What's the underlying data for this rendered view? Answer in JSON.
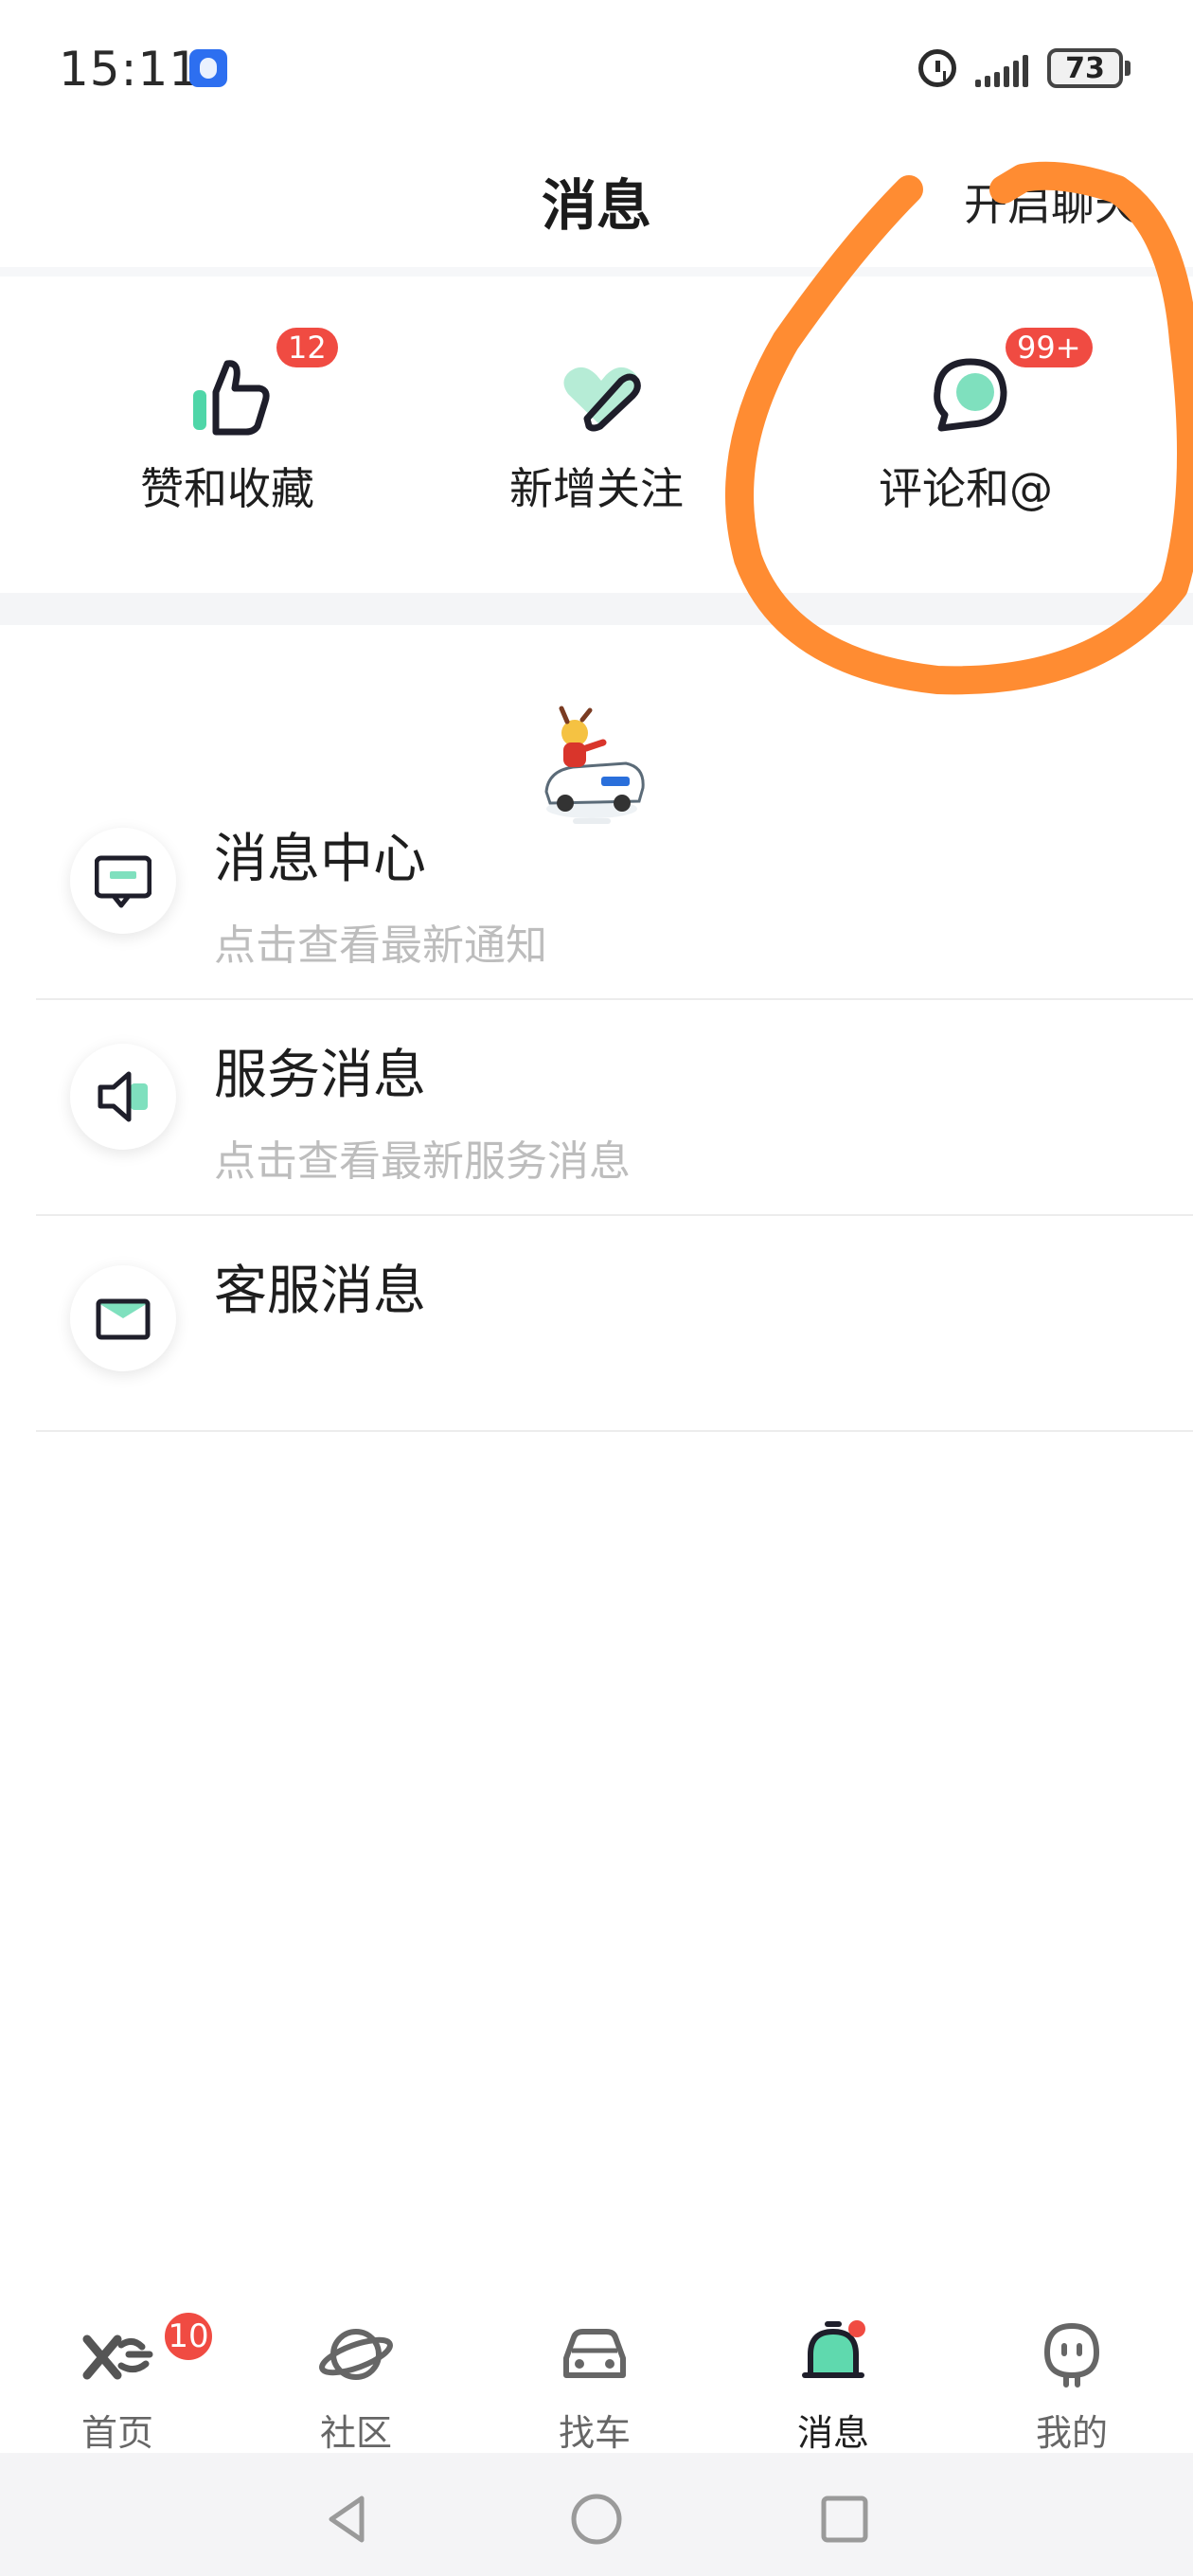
{
  "status_bar": {
    "time": "15:11",
    "battery": "73"
  },
  "header": {
    "title": "消息",
    "action_label": "开启聊天"
  },
  "tiles": [
    {
      "label": "赞和收藏",
      "badge": "12",
      "icon": "thumbs-up-icon"
    },
    {
      "label": "新增关注",
      "badge": "",
      "icon": "heart-follow-icon"
    },
    {
      "label": "评论和@",
      "badge": "99+",
      "icon": "comment-bubble-icon"
    }
  ],
  "messages": [
    {
      "title": "消息中心",
      "subtitle": "点击查看最新通知",
      "icon": "message-screen-icon"
    },
    {
      "title": "服务消息",
      "subtitle": "点击查看最新服务消息",
      "icon": "speaker-icon"
    },
    {
      "title": "客服消息",
      "subtitle": "",
      "icon": "mail-icon"
    }
  ],
  "bottom_nav": [
    {
      "label": "首页",
      "badge": "10",
      "icon": "home-logo-icon",
      "active": false
    },
    {
      "label": "社区",
      "icon": "planet-icon",
      "active": false
    },
    {
      "label": "找车",
      "icon": "car-icon",
      "active": false
    },
    {
      "label": "消息",
      "icon": "bell-icon",
      "active": true,
      "dot": true
    },
    {
      "label": "我的",
      "icon": "profile-face-icon",
      "active": false
    }
  ],
  "colors": {
    "accent_red": "#f04b42",
    "brand_mint": "#4fd6a8",
    "annotation_orange": "#ff8c32"
  }
}
